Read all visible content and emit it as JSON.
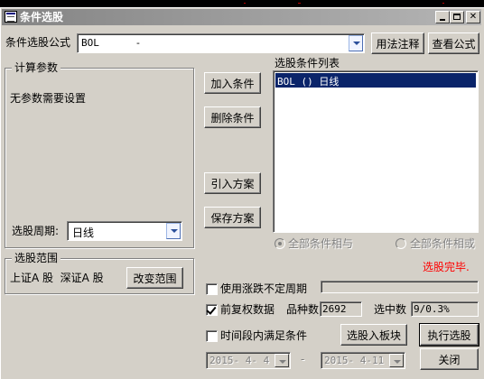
{
  "window": {
    "title": "条件选股"
  },
  "formula": {
    "label": "条件选股公式",
    "value": "BOL      -",
    "btn_usage": "用法注释",
    "btn_view": "查看公式"
  },
  "params": {
    "title": "计算参数",
    "message": "无参数需要设置",
    "period_label": "选股周期:",
    "period_value": "日线"
  },
  "actions": {
    "add": "加入条件",
    "delete": "删除条件",
    "import": "引入方案",
    "save": "保存方案"
  },
  "conditions": {
    "title": "选股条件列表",
    "items": [
      {
        "text": "BOL () 日线",
        "selected": true
      }
    ],
    "radio_all_and": "全部条件相与",
    "radio_all_or": "全部条件相或"
  },
  "status": {
    "text": "选股完毕.",
    "color": "#ff0000"
  },
  "range": {
    "title": "选股范围",
    "value": "上证A 股  深证A 股",
    "btn_change": "改变范围"
  },
  "options": {
    "chk_uncertain": "使用涨跌不定周期",
    "chk_adjust": "前复权数据",
    "count_label": "品种数",
    "count_value": "2692",
    "hit_label": "选中数",
    "hit_value": "9/0.3%",
    "chk_time": "时间段内满足条件",
    "date_from": "2015- 4- 4",
    "date_sep": "-",
    "date_to": "2015- 4-11"
  },
  "bottom": {
    "to_block": "选股入板块",
    "execute": "执行选股",
    "close": "关闭"
  }
}
